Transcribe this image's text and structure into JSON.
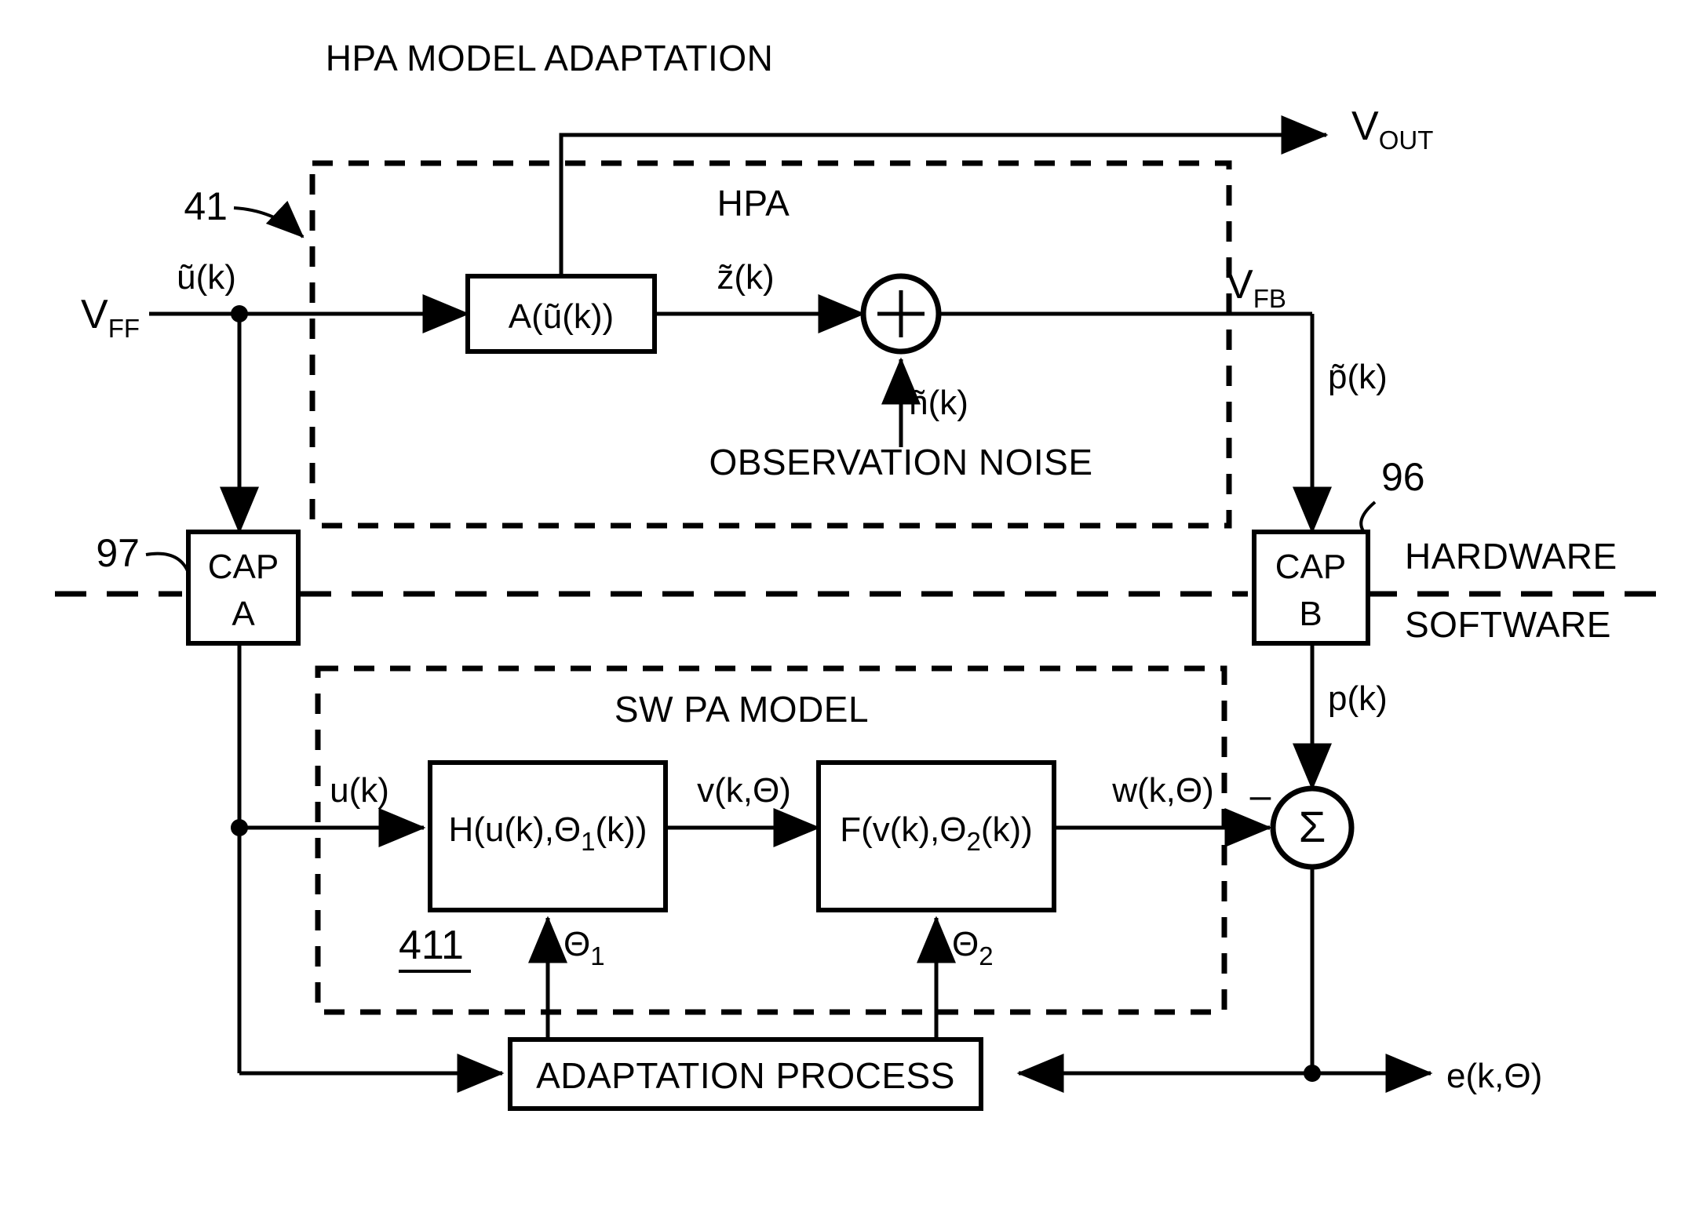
{
  "diagram": {
    "title": "HPA MODEL ADAPTATION",
    "hardware_label": "HARDWARE",
    "software_label": "SOFTWARE",
    "hpa_box_label": "HPA",
    "sw_box_label": "SW PA MODEL",
    "observation_noise_label": "OBSERVATION NOISE"
  },
  "references": {
    "ref_41": "41",
    "ref_96": "96",
    "ref_97": "97",
    "ref_411": "411"
  },
  "blocks": {
    "hpa_amp": "A(ũ(k))",
    "cap_a_line1": "CAP",
    "cap_a_line2": "A",
    "cap_b_line1": "CAP",
    "cap_b_line2": "B",
    "h_block": "H(u(k),Θ",
    "h_block_sub": "1",
    "h_block_tail": "(k))",
    "f_block": "F(v(k),Θ",
    "f_block_sub": "2",
    "f_block_tail": "(k))",
    "adaptation_process": "ADAPTATION PROCESS"
  },
  "signals": {
    "v_ff_base": "V",
    "v_ff_sub": "FF",
    "v_out_base": "V",
    "v_out_sub": "OUT",
    "v_fb_base": "V",
    "v_fb_sub": "FB",
    "u_tilde": "ũ(k)",
    "z_tilde": "z̃(k)",
    "n_tilde": "ñ(k)",
    "p_tilde": "p̃(k)",
    "p_k": "p(k)",
    "u_k": "u(k)",
    "v_k_theta": "v(k,Θ)",
    "w_k_theta": "w(k,Θ)",
    "e_k_theta": "e(k,Θ)",
    "theta_1": "Θ",
    "theta_1_sub": "1",
    "theta_2": "Θ",
    "theta_2_sub": "2"
  },
  "operators": {
    "plus": "+",
    "sigma": "Σ",
    "minus": "–"
  },
  "colors": {
    "ink": "#000000",
    "paper": "#ffffff"
  }
}
